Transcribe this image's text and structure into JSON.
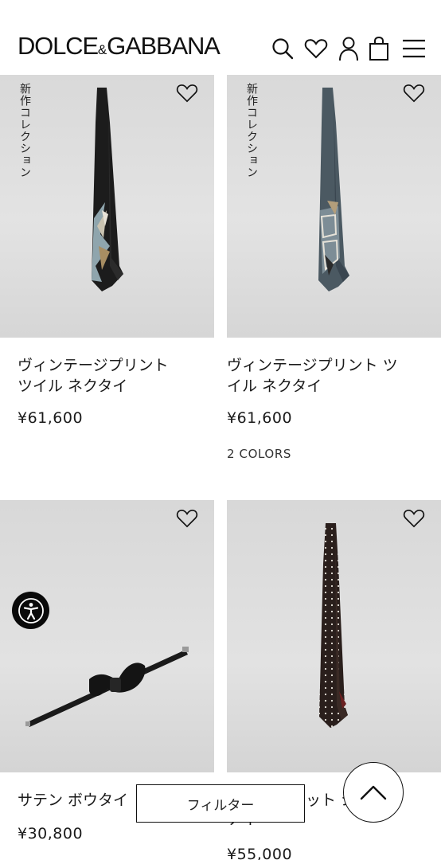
{
  "header": {
    "brand_left": "DOLCE",
    "brand_amp": "&",
    "brand_right": "GABBANA",
    "icons": [
      "search-icon",
      "heart-icon",
      "user-icon",
      "bag-icon",
      "menu-icon"
    ]
  },
  "products": [
    {
      "badge": "新作コレクション",
      "name": "ヴィンテージプリントツイル ネクタイ",
      "price": "¥61,600",
      "colors": ""
    },
    {
      "badge": "新作コレクション",
      "name": "ヴィンテージプリント ツイル ネクタイ",
      "price": "¥61,600",
      "colors": "2 COLORS"
    },
    {
      "badge": "",
      "name": "サテン ボウタイ",
      "price": "¥30,800",
      "colors": ""
    },
    {
      "badge": "",
      "name": "ドットシ ルクタイ",
      "price": "¥55,000",
      "colors": ""
    }
  ],
  "product_names_display": {
    "p1_line1": "ヴィンテージプリント",
    "p1_line2": "ツイル ネクタイ",
    "p2_line1": "ヴィンテージプリント ツ",
    "p2_line2": "イル ネクタイ",
    "p3_line1": "サテン ボウタイ",
    "p4_line1": "ット シ",
    "p4_line2": "ナイ"
  },
  "controls": {
    "filter_label": "フィルター",
    "back_to_top": "chevron-up-icon",
    "accessibility": "accessibility-icon"
  },
  "colors": {
    "text": "#1a1a1a",
    "image_bg": "#e0e0e0",
    "accent_dark": "#0a0a0a"
  }
}
